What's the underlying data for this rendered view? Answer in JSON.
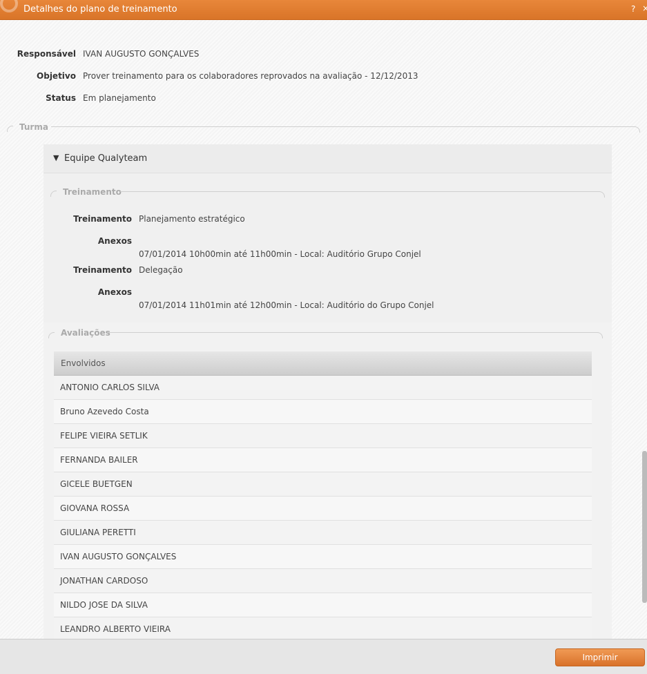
{
  "dialog": {
    "title": "Detalhes do plano de treinamento",
    "help": "?",
    "close": "×"
  },
  "fields": {
    "responsavel_label": "Responsável",
    "responsavel_value": "IVAN AUGUSTO GONÇALVES",
    "objetivo_label": "Objetivo",
    "objetivo_value": "Prover treinamento para os colaboradores reprovados na avaliação - 12/12/2013",
    "status_label": "Status",
    "status_value": "Em planejamento"
  },
  "turma": {
    "legend": "Turma",
    "panel_title": "Equipe Qualyteam",
    "treinamento_legend": "Treinamento",
    "trainings": [
      {
        "label": "Treinamento",
        "name": "Planejamento estratégico",
        "anexos_label": "Anexos",
        "schedule": "07/01/2014 10h00min até 11h00min - Local: Auditório Grupo Conjel"
      },
      {
        "label": "Treinamento",
        "name": "Delegação",
        "anexos_label": "Anexos",
        "schedule": "07/01/2014 11h01min até 12h00min - Local: Auditório do Grupo Conjel"
      }
    ]
  },
  "avaliacoes": {
    "legend": "Avaliações",
    "column_header": "Envolvidos",
    "rows": [
      "ANTONIO CARLOS SILVA",
      "Bruno Azevedo Costa",
      "FELIPE VIEIRA SETLIK",
      "FERNANDA BAILER",
      "GICELE BUETGEN",
      "GIOVANA ROSSA",
      "GIULIANA PERETTI",
      "IVAN AUGUSTO GONÇALVES",
      "JONATHAN CARDOSO",
      "NILDO JOSE DA SILVA",
      "LEANDRO ALBERTO VIEIRA"
    ]
  },
  "footer": {
    "print_label": "Imprimir"
  },
  "colors": {
    "accent": "#e07f32",
    "panel_bg": "#f0f0f0"
  }
}
